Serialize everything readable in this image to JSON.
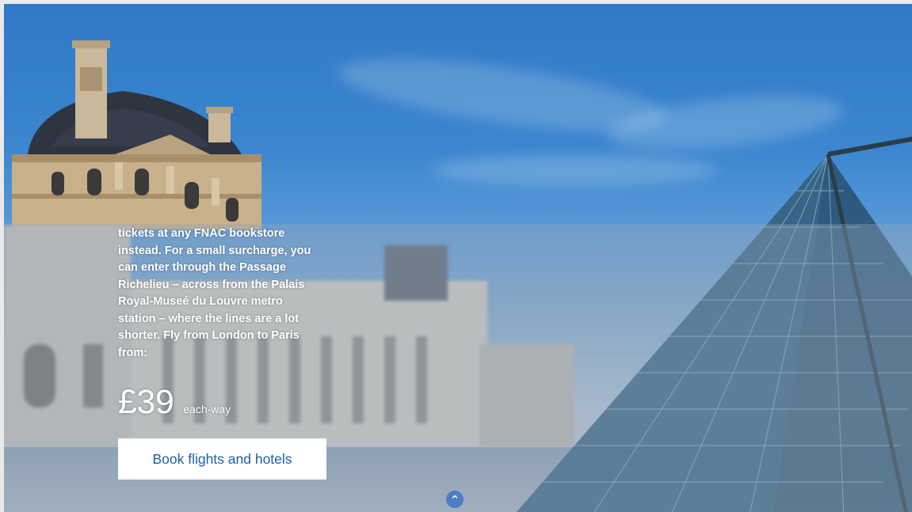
{
  "promo": {
    "body_lines": [
      "tickets at any FNAC bookstore",
      "instead. For a small surcharge, you",
      "can enter through the Passage",
      "Richelieu – across from the Palais",
      "Royal-Museé du Louvre metro",
      "station – where the lines are a lot",
      "shorter. Fly from London to Paris",
      "from:"
    ],
    "price": "£39",
    "price_suffix": "each-way",
    "cta_label": "Book flights and hotels",
    "scroll_up_label": "^"
  },
  "colors": {
    "cta_text": "#1b5fa8",
    "cta_background": "#ffffff",
    "scroll_up_background": "#4c7fc2"
  },
  "icons": {
    "scroll_up": "chevron-up-icon"
  }
}
